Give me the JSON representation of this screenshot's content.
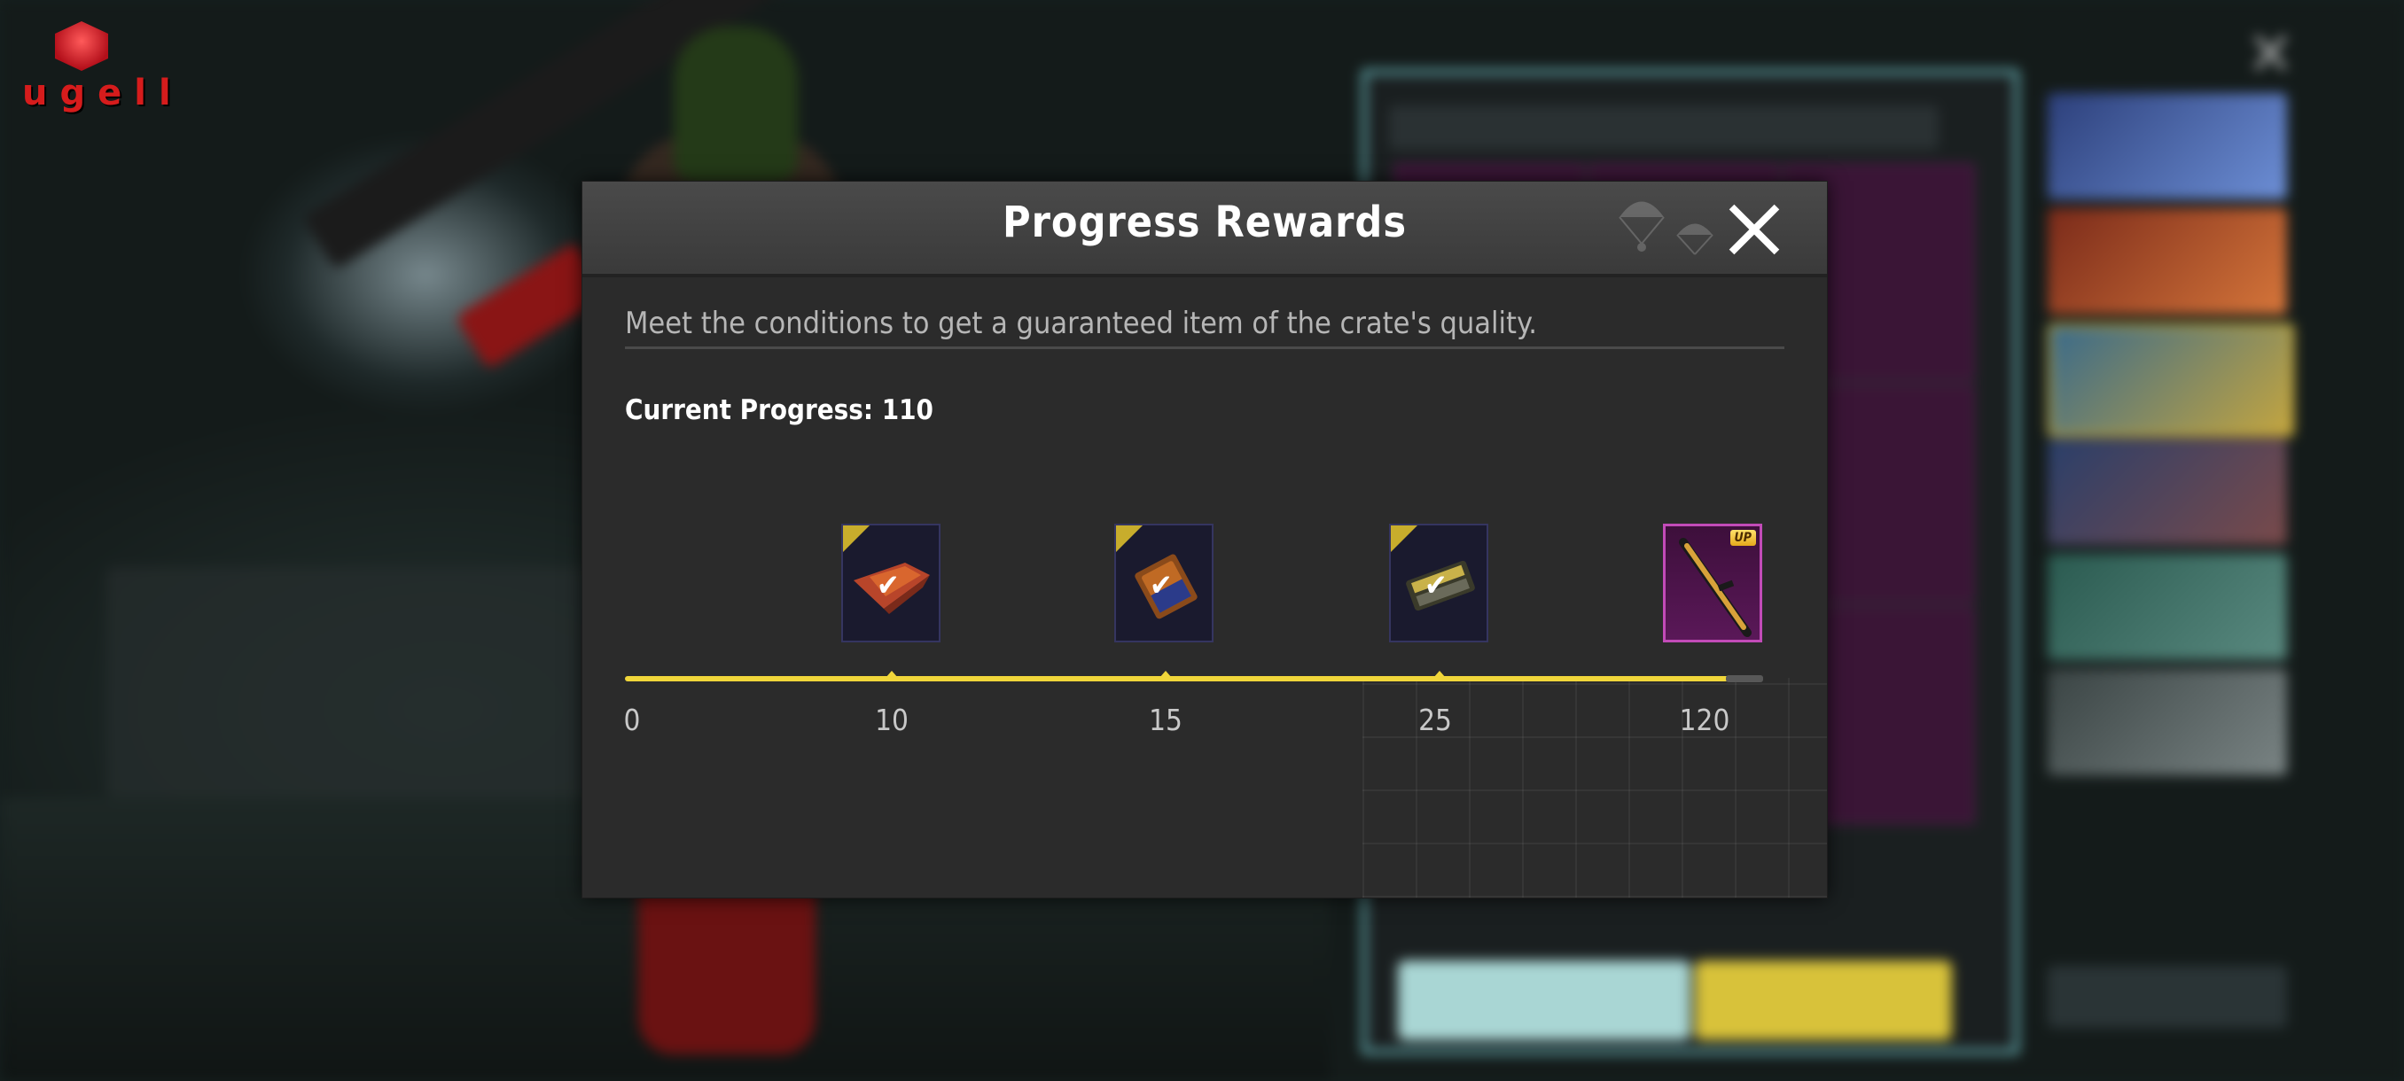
{
  "logo": {
    "text": "ugell"
  },
  "modal": {
    "title": "Progress Rewards",
    "description": "Meet the conditions to get a guaranteed item of the crate's quality.",
    "current_progress": "Current Progress: 110"
  },
  "milestones": [
    {
      "label": "0"
    },
    {
      "label": "10",
      "reward": "parachute-icon",
      "claimed": true
    },
    {
      "label": "15",
      "reward": "emote-card-icon",
      "claimed": true
    },
    {
      "label": "25",
      "reward": "loot-crate-icon",
      "claimed": true
    },
    {
      "label": "120",
      "reward": "rifle-skin-icon",
      "claimed": false,
      "badge": "UP"
    }
  ],
  "progress_value": 110,
  "progress_max": 120,
  "colors": {
    "track": "#f0d63a",
    "modal_bg": "#2b2b2b",
    "claimed_corner": "#c8ad2c",
    "epic_item_border": "#c24bb8",
    "modal_edge": "#5ed4e1"
  }
}
